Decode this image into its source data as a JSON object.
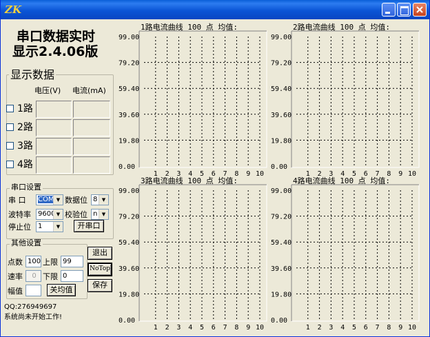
{
  "window": {
    "title": ""
  },
  "app": {
    "heading_line1": "串口数据实时",
    "heading_line2": "显示2.4.06版"
  },
  "display_group": {
    "title": "显示数据",
    "col_voltage": "电压(V)",
    "col_current": "电流(mA)",
    "channels": [
      "1路",
      "2路",
      "3路",
      "4路"
    ]
  },
  "serial_group": {
    "title": "串口设置",
    "port_label": "串  口",
    "port_value": "COM",
    "databits_label": "数据位",
    "databits_value": "8",
    "baud_label": "波特率",
    "baud_value": "9600",
    "parity_label": "校验位",
    "parity_value": "n",
    "stopbits_label": "停止位",
    "stopbits_value": "1",
    "open_button": "开串口"
  },
  "other_group": {
    "title": "其他设置",
    "points_label": "点数",
    "points_value": "100",
    "upper_label": "上限",
    "upper_value": "99",
    "rate_label": "速率",
    "rate_value": "0",
    "lower_label": "下限",
    "lower_value": "0",
    "amp_label": "幅值",
    "amp_value": "",
    "avg_button": "关均值"
  },
  "buttons": {
    "exit": "退出",
    "notop": "NoTop",
    "save": "保存"
  },
  "footer": {
    "qq": "QQ:276949697",
    "status": "系统尚未开始工作!"
  },
  "charts": [
    {
      "title": "1路电流曲线",
      "points": "100 点",
      "avg": "均值:"
    },
    {
      "title": "2路电流曲线",
      "points": "100 点",
      "avg": "均值:"
    },
    {
      "title": "3路电流曲线",
      "points": "100 点",
      "avg": "均值:"
    },
    {
      "title": "4路电流曲线",
      "points": "100 点",
      "avg": "均值:"
    }
  ],
  "chart_data": [
    {
      "type": "line",
      "title": "1路电流曲线",
      "y_ticks": [
        "99.00",
        "79.20",
        "59.40",
        "39.60",
        "19.80",
        "0.00"
      ],
      "x_ticks": [
        "1",
        "2",
        "3",
        "4",
        "5",
        "6",
        "7",
        "8",
        "9",
        "10"
      ],
      "ylim": [
        0,
        99
      ],
      "grid": true,
      "series": []
    },
    {
      "type": "line",
      "title": "2路电流曲线",
      "y_ticks": [
        "99.00",
        "79.20",
        "59.40",
        "39.60",
        "19.80",
        "0.00"
      ],
      "x_ticks": [
        "1",
        "2",
        "3",
        "4",
        "5",
        "6",
        "7",
        "8",
        "9",
        "10"
      ],
      "ylim": [
        0,
        99
      ],
      "grid": true,
      "series": []
    },
    {
      "type": "line",
      "title": "3路电流曲线",
      "y_ticks": [
        "99.00",
        "79.20",
        "59.40",
        "39.60",
        "19.80",
        "0.00"
      ],
      "x_ticks": [
        "1",
        "2",
        "3",
        "4",
        "5",
        "6",
        "7",
        "8",
        "9",
        "10"
      ],
      "ylim": [
        0,
        99
      ],
      "grid": true,
      "series": []
    },
    {
      "type": "line",
      "title": "4路电流曲线",
      "y_ticks": [
        "99.00",
        "79.20",
        "59.40",
        "39.60",
        "19.80",
        "0.00"
      ],
      "x_ticks": [
        "1",
        "2",
        "3",
        "4",
        "5",
        "6",
        "7",
        "8",
        "9",
        "10"
      ],
      "ylim": [
        0,
        99
      ],
      "grid": true,
      "series": []
    }
  ],
  "colors": {
    "titlebar": "#0b55d6",
    "face": "#ece9d8",
    "chart_bg": "#ece9d8",
    "grid": "#000000",
    "selection": "#316ac5"
  }
}
